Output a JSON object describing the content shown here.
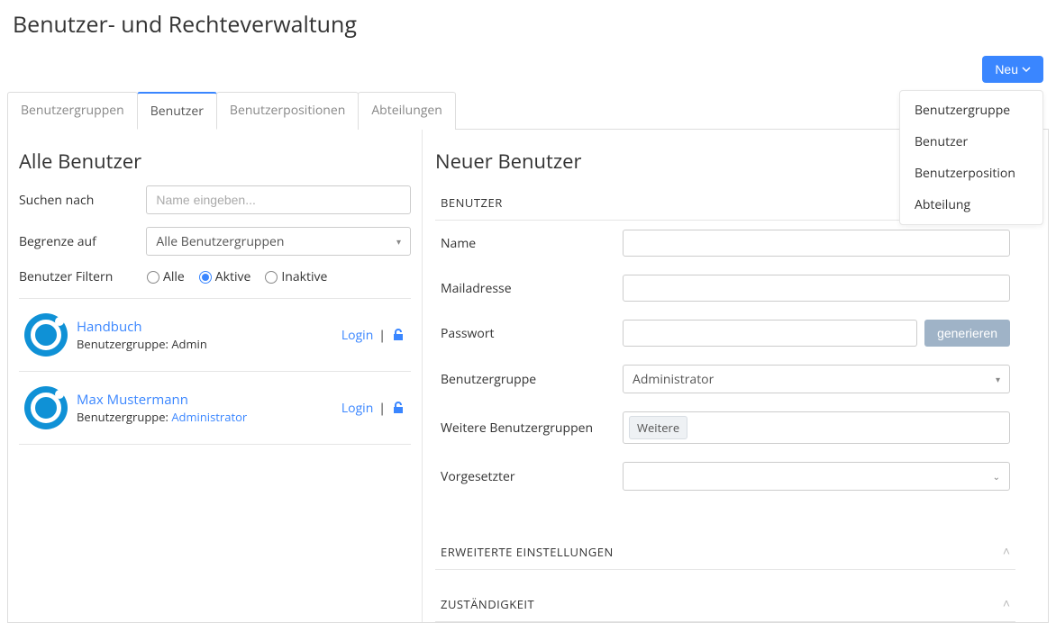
{
  "page_title": "Benutzer- und Rechteverwaltung",
  "neu_button": "Neu",
  "neu_menu": [
    "Benutzergruppe",
    "Benutzer",
    "Benutzerposition",
    "Abteilung"
  ],
  "tabs": [
    {
      "label": "Benutzergruppen",
      "active": false
    },
    {
      "label": "Benutzer",
      "active": true
    },
    {
      "label": "Benutzerpositionen",
      "active": false
    },
    {
      "label": "Abteilungen",
      "active": false
    }
  ],
  "left": {
    "title": "Alle Benutzer",
    "search_label": "Suchen nach",
    "search_placeholder": "Name eingeben...",
    "limit_label": "Begrenze auf",
    "limit_value": "Alle Benutzergruppen",
    "filter_label": "Benutzer Filtern",
    "filter_options": {
      "all": "Alle",
      "active": "Aktive",
      "inactive": "Inaktive"
    },
    "filter_selected": "active",
    "group_prefix": "Benutzergruppe: ",
    "login_label": "Login",
    "users": [
      {
        "name": "Handbuch",
        "group": "Admin",
        "group_link": false
      },
      {
        "name": "Max Mustermann",
        "group": "Administrator",
        "group_link": true
      }
    ]
  },
  "right": {
    "title": "Neuer Benutzer",
    "section_user": "BENUTZER",
    "fields": {
      "name": "Name",
      "mail": "Mailadresse",
      "password": "Passwort",
      "generate": "generieren",
      "group": "Benutzergruppe",
      "group_value": "Administrator",
      "more_groups": "Weitere Benutzergruppen",
      "more_groups_tag": "Weitere",
      "supervisor": "Vorgesetzter"
    },
    "section_advanced": "ERWEITERTE EINSTELLUNGEN",
    "section_responsibility": "ZUSTÄNDIGKEIT"
  }
}
